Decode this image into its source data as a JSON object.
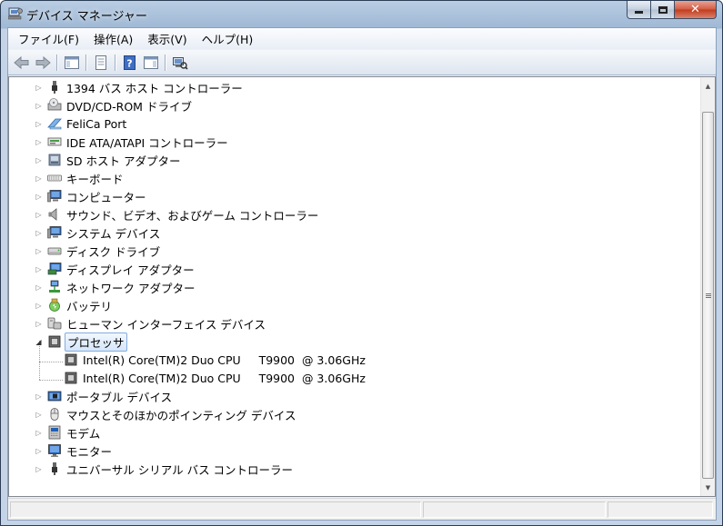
{
  "window": {
    "title": "デバイス マネージャー"
  },
  "menu": [
    {
      "label": "ファイル(F)",
      "name": "menu-file"
    },
    {
      "label": "操作(A)",
      "name": "menu-action"
    },
    {
      "label": "表示(V)",
      "name": "menu-view"
    },
    {
      "label": "ヘルプ(H)",
      "name": "menu-help"
    }
  ],
  "toolbar": [
    {
      "name": "back-button",
      "icon": "back-arrow-icon"
    },
    {
      "name": "forward-button",
      "icon": "forward-arrow-icon"
    },
    {
      "name": "show-hide-console-tree-button",
      "icon": "console-tree-icon"
    },
    {
      "name": "properties-button",
      "icon": "properties-icon"
    },
    {
      "name": "help-button",
      "icon": "help-icon"
    },
    {
      "name": "show-action-pane-button",
      "icon": "action-pane-icon"
    },
    {
      "name": "scan-hardware-changes-button",
      "icon": "scan-hardware-icon"
    }
  ],
  "tree": {
    "items": [
      {
        "label": "1394 バス ホスト コントローラー",
        "icon": "usb-plug-icon",
        "expander": "collapsed",
        "level": 0
      },
      {
        "label": "DVD/CD-ROM ドライブ",
        "icon": "dvd-drive-icon",
        "expander": "collapsed",
        "level": 0
      },
      {
        "label": "FeliCa Port",
        "icon": "felica-icon",
        "expander": "collapsed",
        "level": 0
      },
      {
        "label": "IDE ATA/ATAPI コントローラー",
        "icon": "ide-controller-icon",
        "expander": "collapsed",
        "level": 0
      },
      {
        "label": "SD ホスト アダプター",
        "icon": "sd-host-icon",
        "expander": "collapsed",
        "level": 0
      },
      {
        "label": "キーボード",
        "icon": "keyboard-icon",
        "expander": "collapsed",
        "level": 0
      },
      {
        "label": "コンピューター",
        "icon": "computer-icon",
        "expander": "collapsed",
        "level": 0
      },
      {
        "label": "サウンド、ビデオ、およびゲーム コントローラー",
        "icon": "speaker-icon",
        "expander": "collapsed",
        "level": 0
      },
      {
        "label": "システム デバイス",
        "icon": "system-device-icon",
        "expander": "collapsed",
        "level": 0
      },
      {
        "label": "ディスク ドライブ",
        "icon": "disk-drive-icon",
        "expander": "collapsed",
        "level": 0
      },
      {
        "label": "ディスプレイ アダプター",
        "icon": "display-adapter-icon",
        "expander": "collapsed",
        "level": 0
      },
      {
        "label": "ネットワーク アダプター",
        "icon": "network-adapter-icon",
        "expander": "collapsed",
        "level": 0
      },
      {
        "label": "バッテリ",
        "icon": "battery-icon",
        "expander": "collapsed",
        "level": 0
      },
      {
        "label": "ヒューマン インターフェイス デバイス",
        "icon": "hid-icon",
        "expander": "collapsed",
        "level": 0
      },
      {
        "label": "プロセッサ",
        "icon": "processor-icon",
        "expander": "expanded",
        "level": 0,
        "selected": true
      },
      {
        "label": "Intel(R) Core(TM)2 Duo CPU     T9900  @ 3.06GHz",
        "icon": "processor-icon",
        "expander": "none",
        "level": 1
      },
      {
        "label": "Intel(R) Core(TM)2 Duo CPU     T9900  @ 3.06GHz",
        "icon": "processor-icon",
        "expander": "none",
        "level": 1
      },
      {
        "label": "ポータブル デバイス",
        "icon": "portable-device-icon",
        "expander": "collapsed",
        "level": 0
      },
      {
        "label": "マウスとそのほかのポインティング デバイス",
        "icon": "mouse-icon",
        "expander": "collapsed",
        "level": 0
      },
      {
        "label": "モデム",
        "icon": "modem-icon",
        "expander": "collapsed",
        "level": 0
      },
      {
        "label": "モニター",
        "icon": "monitor-icon",
        "expander": "collapsed",
        "level": 0
      },
      {
        "label": "ユニバーサル シリアル バス コントローラー",
        "icon": "usb-plug-icon",
        "expander": "collapsed",
        "level": 0
      }
    ]
  },
  "statusbar": {
    "text": ""
  }
}
